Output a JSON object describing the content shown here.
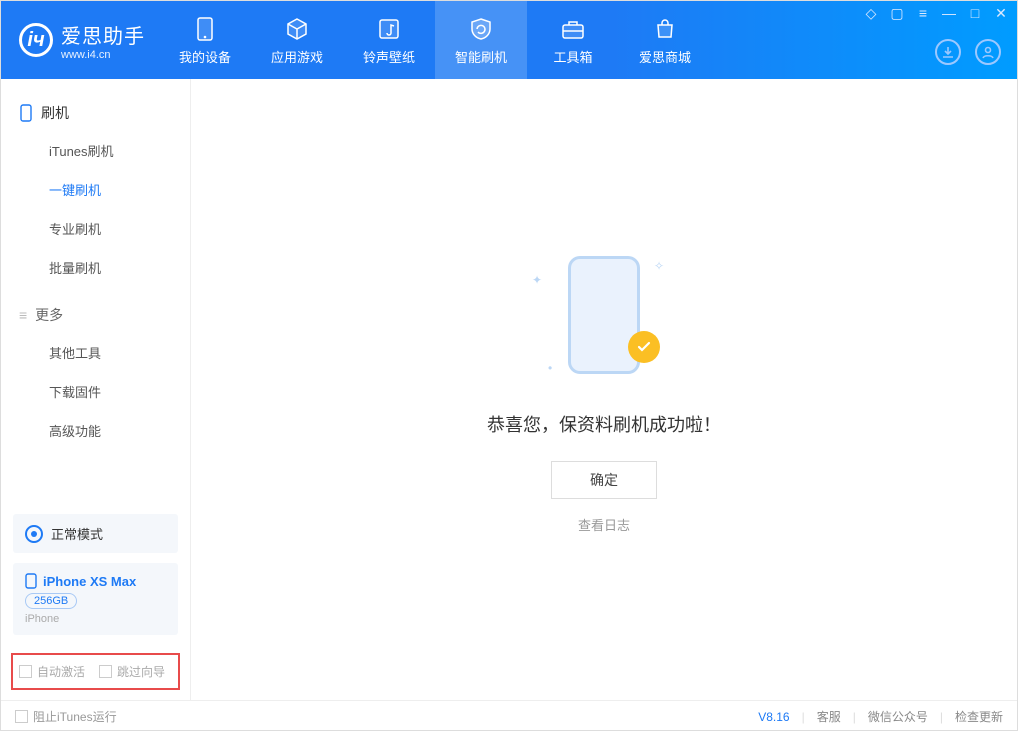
{
  "app": {
    "title": "爱思助手",
    "subtitle": "www.i4.cn"
  },
  "nav": {
    "items": [
      {
        "label": "我的设备"
      },
      {
        "label": "应用游戏"
      },
      {
        "label": "铃声壁纸"
      },
      {
        "label": "智能刷机"
      },
      {
        "label": "工具箱"
      },
      {
        "label": "爱思商城"
      }
    ],
    "active_index": 3
  },
  "sidebar": {
    "group1": {
      "title": "刷机",
      "items": [
        "iTunes刷机",
        "一键刷机",
        "专业刷机",
        "批量刷机"
      ],
      "active_index": 1
    },
    "group2": {
      "title": "更多",
      "items": [
        "其他工具",
        "下载固件",
        "高级功能"
      ]
    },
    "mode": "正常模式",
    "device": {
      "name": "iPhone XS Max",
      "storage": "256GB",
      "type": "iPhone"
    },
    "options": {
      "auto_activate": "自动激活",
      "skip_wizard": "跳过向导"
    }
  },
  "main": {
    "success_text": "恭喜您，保资料刷机成功啦！",
    "ok_button": "确定",
    "view_log": "查看日志"
  },
  "footer": {
    "block_itunes": "阻止iTunes运行",
    "version": "V8.16",
    "links": [
      "客服",
      "微信公众号",
      "检查更新"
    ]
  }
}
